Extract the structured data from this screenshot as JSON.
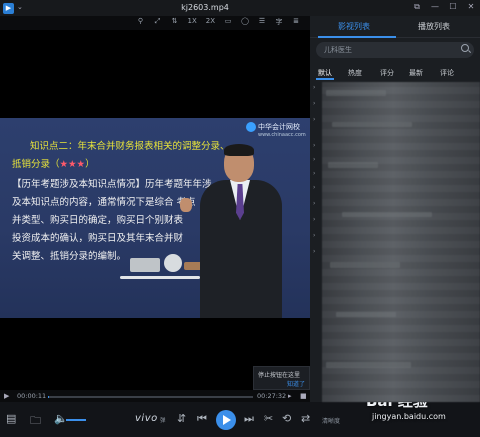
{
  "window": {
    "title": "kj2603.mp4",
    "logo_glyph": "▶",
    "dropdown_glyph": "⌄",
    "controls": [
      "⧉",
      "—",
      "☐",
      "✕"
    ]
  },
  "toolbar": {
    "items": [
      "⚲",
      "⤢",
      "⇅",
      "1X",
      "2X",
      "▭",
      "◯",
      "☰",
      "字",
      "≣"
    ]
  },
  "slide": {
    "brand": "中华会计网校",
    "brand_url": "www.chinaacc.com",
    "title_line1": "知识点二：年末合并财务报表相关的调整分录、",
    "title_line2": "抵销分录（",
    "stars": "★★★",
    "title_close": "）",
    "lines": [
      "【历年考题涉及本知识点情况】历年考题年年涉",
      "及本知识点的内容，通常情况下是综合",
      "并类型、购买日的确定，购买日个别财",
      "投资成本的确认，购买日及其年末合并财",
      "关调整、抵销分录的编制。"
    ],
    "line_suffix": [
      "",
      "  考点",
      "表",
      "",
      ""
    ]
  },
  "toast": {
    "text": "停止按钮在这里",
    "link": "知道了"
  },
  "progress": {
    "current": "00:00:11",
    "total": "00:27:32",
    "fraction": 0.0067
  },
  "controls": {
    "brand": "vivo",
    "brand_sub": "弹",
    "clear_label": "清晰度",
    "watermark": "Bai 经验",
    "watermark_url": "jingyan.baidu.com"
  },
  "panel": {
    "tabs": [
      "影视列表",
      "播放列表"
    ],
    "search_placeholder": "儿科医生",
    "sorts": [
      "默认",
      "热度",
      "评分",
      "最新",
      "评论"
    ]
  }
}
